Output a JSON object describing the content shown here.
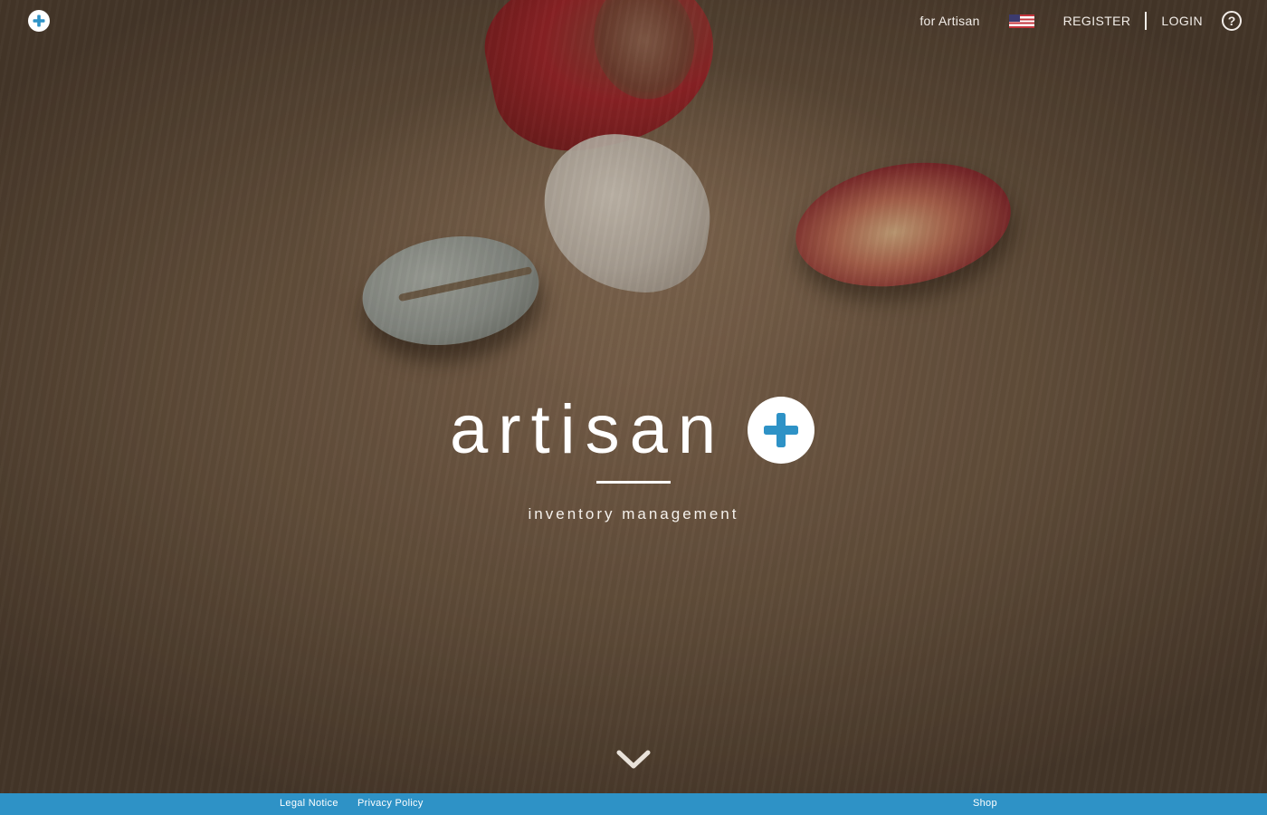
{
  "header": {
    "for_label": "for Artisan",
    "language_flag_icon": "us-flag-icon",
    "register_label": "REGISTER",
    "login_label": "LOGIN",
    "help_icon": "question-circle-icon",
    "logo_icon": "plus-circle-icon"
  },
  "hero": {
    "brand_name": "artisan",
    "tagline": "inventory management",
    "scroll_icon": "chevron-down-icon"
  },
  "footer": {
    "legal_label": "Legal Notice",
    "privacy_label": "Privacy Policy",
    "shop_label": "Shop"
  },
  "colors": {
    "accent": "#2e92c6",
    "text_on_photo": "#ffffff"
  }
}
